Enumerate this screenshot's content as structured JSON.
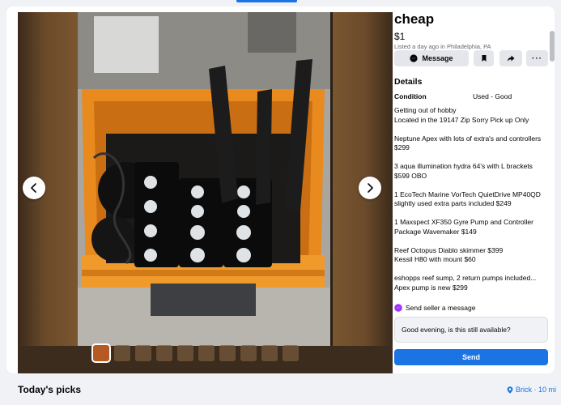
{
  "listing": {
    "title": "cheap",
    "price": "$1",
    "listed": "Listed a day ago in Philadelphia, PA"
  },
  "actions": {
    "message_label": "Message",
    "save_icon": "bookmark-icon",
    "share_icon": "share-icon",
    "more_label": "···"
  },
  "details": {
    "heading": "Details",
    "condition_label": "Condition",
    "condition_value": "Used - Good",
    "description": [
      "Getting out of hobby\nLocated in the 19147 Zip Sorry Pick up Only",
      "Neptune Apex with lots of extra's and controllers $299",
      "3 aqua illumination hydra 64's with L brackets $599 OBO",
      "1 EcoTech Marine VorTech QuietDrive MP40QD slightly used extra parts included $249",
      "1 Maxspect XF350 Gyre Pump and Controller Package Wavemaker $149",
      "Reef Octopus Diablo skimmer $399\nKessil H80 with mount $60",
      "eshopps reef sump, 2 return pumps included... Apex pump is new  $299"
    ]
  },
  "message": {
    "prompt": "Send seller a message",
    "input_value": "Good evening, is this still available?",
    "send_label": "Send"
  },
  "footer": {
    "section_title": "Today's picks",
    "location": "Brick · 10 mi"
  },
  "colors": {
    "accent": "#1b74e4",
    "bin_orange": "#e98a1f"
  }
}
